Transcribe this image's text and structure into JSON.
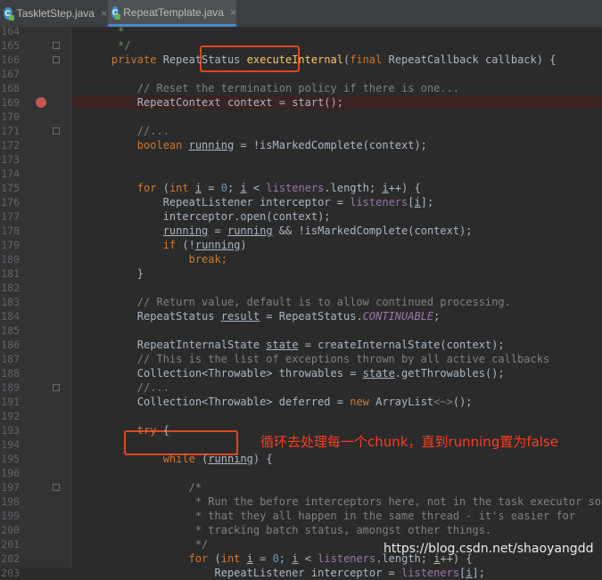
{
  "tabs": [
    {
      "icon": "c-class-icon",
      "label": "TaskletStep.java",
      "active": false
    },
    {
      "icon": "c-class-icon",
      "label": "RepeatTemplate.java",
      "active": true
    }
  ],
  "tab_close_glyph": "×",
  "accent_colors": {
    "highlight_box": "#e0461f",
    "annotation_text": "#ff3b1d",
    "breakpoint": "#c75450"
  },
  "lines": [
    {
      "n": "164",
      "segs": [
        {
          "t": "     "
        },
        {
          "t": "*",
          "c": "ic"
        }
      ]
    },
    {
      "n": "165",
      "segs": [
        {
          "t": "     "
        },
        {
          "t": "*/",
          "c": "ic"
        }
      ]
    },
    {
      "n": "166",
      "segs": [
        {
          "t": "    "
        },
        {
          "t": "private ",
          "c": "kw"
        },
        {
          "t": "RepeatStatus "
        },
        {
          "t": "executeInternal",
          "c": "fn"
        },
        {
          "t": "("
        },
        {
          "t": "final ",
          "c": "kw"
        },
        {
          "t": "RepeatCallback callback) {"
        }
      ]
    },
    {
      "n": "167",
      "segs": []
    },
    {
      "n": "168",
      "segs": [
        {
          "t": "        "
        },
        {
          "t": "// Reset the termination policy if there is one...",
          "c": "cm"
        }
      ]
    },
    {
      "n": "169",
      "segs": [
        {
          "t": "        RepeatContext context = start();"
        }
      ]
    },
    {
      "n": "170",
      "segs": []
    },
    {
      "n": "171",
      "segs": [
        {
          "t": "        "
        },
        {
          "t": "//...",
          "c": "cm"
        }
      ]
    },
    {
      "n": "172",
      "segs": [
        {
          "t": "        "
        },
        {
          "t": "boolean ",
          "c": "kw"
        },
        {
          "t": "running",
          "c": "ul"
        },
        {
          "t": " = !isMarkedComplete(context);"
        }
      ]
    },
    {
      "n": "173",
      "segs": []
    },
    {
      "n": "174",
      "segs": []
    },
    {
      "n": "175",
      "segs": [
        {
          "t": "        "
        },
        {
          "t": "for ",
          "c": "kw"
        },
        {
          "t": "("
        },
        {
          "t": "int ",
          "c": "kw"
        },
        {
          "t": "i",
          "c": "ul"
        },
        {
          "t": " = "
        },
        {
          "t": "0",
          "c": "num"
        },
        {
          "t": "; "
        },
        {
          "t": "i",
          "c": "ul"
        },
        {
          "t": " < "
        },
        {
          "t": "listeners",
          "c": "fld"
        },
        {
          "t": ".length; "
        },
        {
          "t": "i",
          "c": "ul"
        },
        {
          "t": "++) {"
        }
      ]
    },
    {
      "n": "176",
      "segs": [
        {
          "t": "            RepeatListener interceptor = "
        },
        {
          "t": "listeners",
          "c": "fld"
        },
        {
          "t": "["
        },
        {
          "t": "i",
          "c": "ul"
        },
        {
          "t": "];"
        }
      ]
    },
    {
      "n": "177",
      "segs": [
        {
          "t": "            interceptor.open(context);"
        }
      ]
    },
    {
      "n": "178",
      "segs": [
        {
          "t": "            "
        },
        {
          "t": "running",
          "c": "ul"
        },
        {
          "t": " = "
        },
        {
          "t": "running",
          "c": "ul"
        },
        {
          "t": " && !isMarkedComplete(context);"
        }
      ]
    },
    {
      "n": "179",
      "segs": [
        {
          "t": "            "
        },
        {
          "t": "if ",
          "c": "kw"
        },
        {
          "t": "(!"
        },
        {
          "t": "running",
          "c": "ul"
        },
        {
          "t": ")"
        }
      ]
    },
    {
      "n": "180",
      "segs": [
        {
          "t": "                "
        },
        {
          "t": "break;",
          "c": "kw"
        }
      ]
    },
    {
      "n": "181",
      "segs": [
        {
          "t": "        }"
        }
      ]
    },
    {
      "n": "182",
      "segs": []
    },
    {
      "n": "183",
      "segs": [
        {
          "t": "        "
        },
        {
          "t": "// Return value, default is to allow continued processing.",
          "c": "cm"
        }
      ]
    },
    {
      "n": "184",
      "segs": [
        {
          "t": "        RepeatStatus "
        },
        {
          "t": "result",
          "c": "ul"
        },
        {
          "t": " = RepeatStatus."
        },
        {
          "t": "CONTINUABLE",
          "c": "itf"
        },
        {
          "t": ";"
        }
      ]
    },
    {
      "n": "185",
      "segs": []
    },
    {
      "n": "186",
      "segs": [
        {
          "t": "        RepeatInternalState "
        },
        {
          "t": "state",
          "c": "ul"
        },
        {
          "t": " = createInternalState(context);"
        }
      ]
    },
    {
      "n": "187",
      "segs": [
        {
          "t": "        "
        },
        {
          "t": "// This is the list of exceptions thrown by all active callbacks",
          "c": "cm"
        }
      ]
    },
    {
      "n": "188",
      "segs": [
        {
          "t": "        Collection<Throwable> throwables = "
        },
        {
          "t": "state",
          "c": "ul"
        },
        {
          "t": ".getThrowables();"
        }
      ]
    },
    {
      "n": "189",
      "segs": [
        {
          "t": "        "
        },
        {
          "t": "//...",
          "c": "cm"
        }
      ]
    },
    {
      "n": "191",
      "segs": [
        {
          "t": "        Collection<Throwable> deferred = "
        },
        {
          "t": "new ",
          "c": "kw"
        },
        {
          "t": "ArrayList"
        },
        {
          "t": "<~>",
          "c": "cm"
        },
        {
          "t": "();"
        }
      ]
    },
    {
      "n": "192",
      "segs": []
    },
    {
      "n": "193",
      "segs": [
        {
          "t": "        "
        },
        {
          "t": "try ",
          "c": "kw"
        },
        {
          "t": "{"
        }
      ]
    },
    {
      "n": "194",
      "segs": []
    },
    {
      "n": "195",
      "segs": [
        {
          "t": "            "
        },
        {
          "t": "while ",
          "c": "kw"
        },
        {
          "t": "("
        },
        {
          "t": "running",
          "c": "ul"
        },
        {
          "t": ") {"
        }
      ]
    },
    {
      "n": "196",
      "segs": []
    },
    {
      "n": "197",
      "segs": [
        {
          "t": "                "
        },
        {
          "t": "/*",
          "c": "cm"
        }
      ]
    },
    {
      "n": "198",
      "segs": [
        {
          "t": "                 "
        },
        {
          "t": "* Run the before interceptors here, not in the task executor so",
          "c": "cm"
        }
      ]
    },
    {
      "n": "199",
      "segs": [
        {
          "t": "                 "
        },
        {
          "t": "* that they all happen in the same thread - it's easier for",
          "c": "cm"
        }
      ]
    },
    {
      "n": "200",
      "segs": [
        {
          "t": "                 "
        },
        {
          "t": "* tracking batch status, amongst other things.",
          "c": "cm"
        }
      ]
    },
    {
      "n": "201",
      "segs": [
        {
          "t": "                 "
        },
        {
          "t": "*/",
          "c": "cm"
        }
      ]
    },
    {
      "n": "202",
      "segs": [
        {
          "t": "                "
        },
        {
          "t": "for ",
          "c": "kw"
        },
        {
          "t": "("
        },
        {
          "t": "int ",
          "c": "kw"
        },
        {
          "t": "i",
          "c": "ul"
        },
        {
          "t": " = "
        },
        {
          "t": "0",
          "c": "num"
        },
        {
          "t": "; "
        },
        {
          "t": "i",
          "c": "ul"
        },
        {
          "t": " < "
        },
        {
          "t": "listeners",
          "c": "fld"
        },
        {
          "t": ".length; "
        },
        {
          "t": "i",
          "c": "ul"
        },
        {
          "t": "++) {"
        }
      ]
    },
    {
      "n": "203",
      "segs": [
        {
          "t": "                    RepeatListener interceptor = "
        },
        {
          "t": "listeners",
          "c": "fld"
        },
        {
          "t": "["
        },
        {
          "t": "i",
          "c": "ul"
        },
        {
          "t": "];"
        }
      ]
    }
  ],
  "breakpoint_line": "169",
  "annotation": "循环去处理每一个chunk，直到running置为false",
  "watermark": "https://blog.csdn.net/shaoyangdd"
}
